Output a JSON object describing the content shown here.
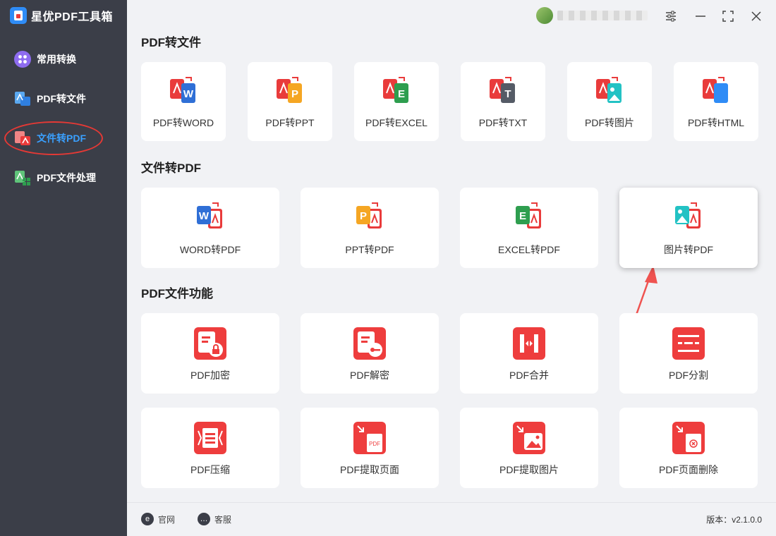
{
  "app": {
    "title": "星优PDF工具箱"
  },
  "colors": {
    "accent": "#3aa0ff",
    "brand_red": "#e93b3b",
    "sidebar_bg": "#3b3e48"
  },
  "sidebar": {
    "items": [
      {
        "label": "常用转换",
        "icon": "apps-icon"
      },
      {
        "label": "PDF转文件",
        "icon": "pdf-to-file-icon"
      },
      {
        "label": "文件转PDF",
        "icon": "file-to-pdf-icon",
        "active": true
      },
      {
        "label": "PDF文件处理",
        "icon": "pdf-process-icon"
      }
    ]
  },
  "sections": {
    "pdf_to_file": {
      "title": "PDF转文件",
      "cards": [
        {
          "label": "PDF转WORD",
          "badge": "W",
          "color": "#2f6fd6"
        },
        {
          "label": "PDF转PPT",
          "badge": "P",
          "color": "#f5a623"
        },
        {
          "label": "PDF转EXCEL",
          "badge": "E",
          "color": "#2e9e4f"
        },
        {
          "label": "PDF转TXT",
          "badge": "T",
          "color": "#555b66"
        },
        {
          "label": "PDF转图片",
          "badge": "img",
          "color": "#23c2c4"
        },
        {
          "label": "PDF转HTML",
          "badge": "</>",
          "color": "#2f8cf6"
        }
      ]
    },
    "file_to_pdf": {
      "title": "文件转PDF",
      "cards": [
        {
          "label": "WORD转PDF",
          "badge": "W",
          "color": "#2f6fd6"
        },
        {
          "label": "PPT转PDF",
          "badge": "P",
          "color": "#f5a623"
        },
        {
          "label": "EXCEL转PDF",
          "badge": "E",
          "color": "#2e9e4f"
        },
        {
          "label": "图片转PDF",
          "badge": "img",
          "color": "#23c2c4"
        }
      ]
    },
    "pdf_functions": {
      "title": "PDF文件功能",
      "cards": [
        {
          "label": "PDF加密",
          "icon": "lock-icon"
        },
        {
          "label": "PDF解密",
          "icon": "key-icon"
        },
        {
          "label": "PDF合并",
          "icon": "merge-icon"
        },
        {
          "label": "PDF分割",
          "icon": "split-icon"
        },
        {
          "label": "PDF压缩",
          "icon": "compress-icon"
        },
        {
          "label": "PDF提取页面",
          "icon": "extract-page-icon"
        },
        {
          "label": "PDF提取图片",
          "icon": "extract-image-icon"
        },
        {
          "label": "PDF页面删除",
          "icon": "delete-page-icon"
        }
      ]
    }
  },
  "footer": {
    "website": "官网",
    "support": "客服",
    "version": "版本：v2.1.0.0"
  }
}
